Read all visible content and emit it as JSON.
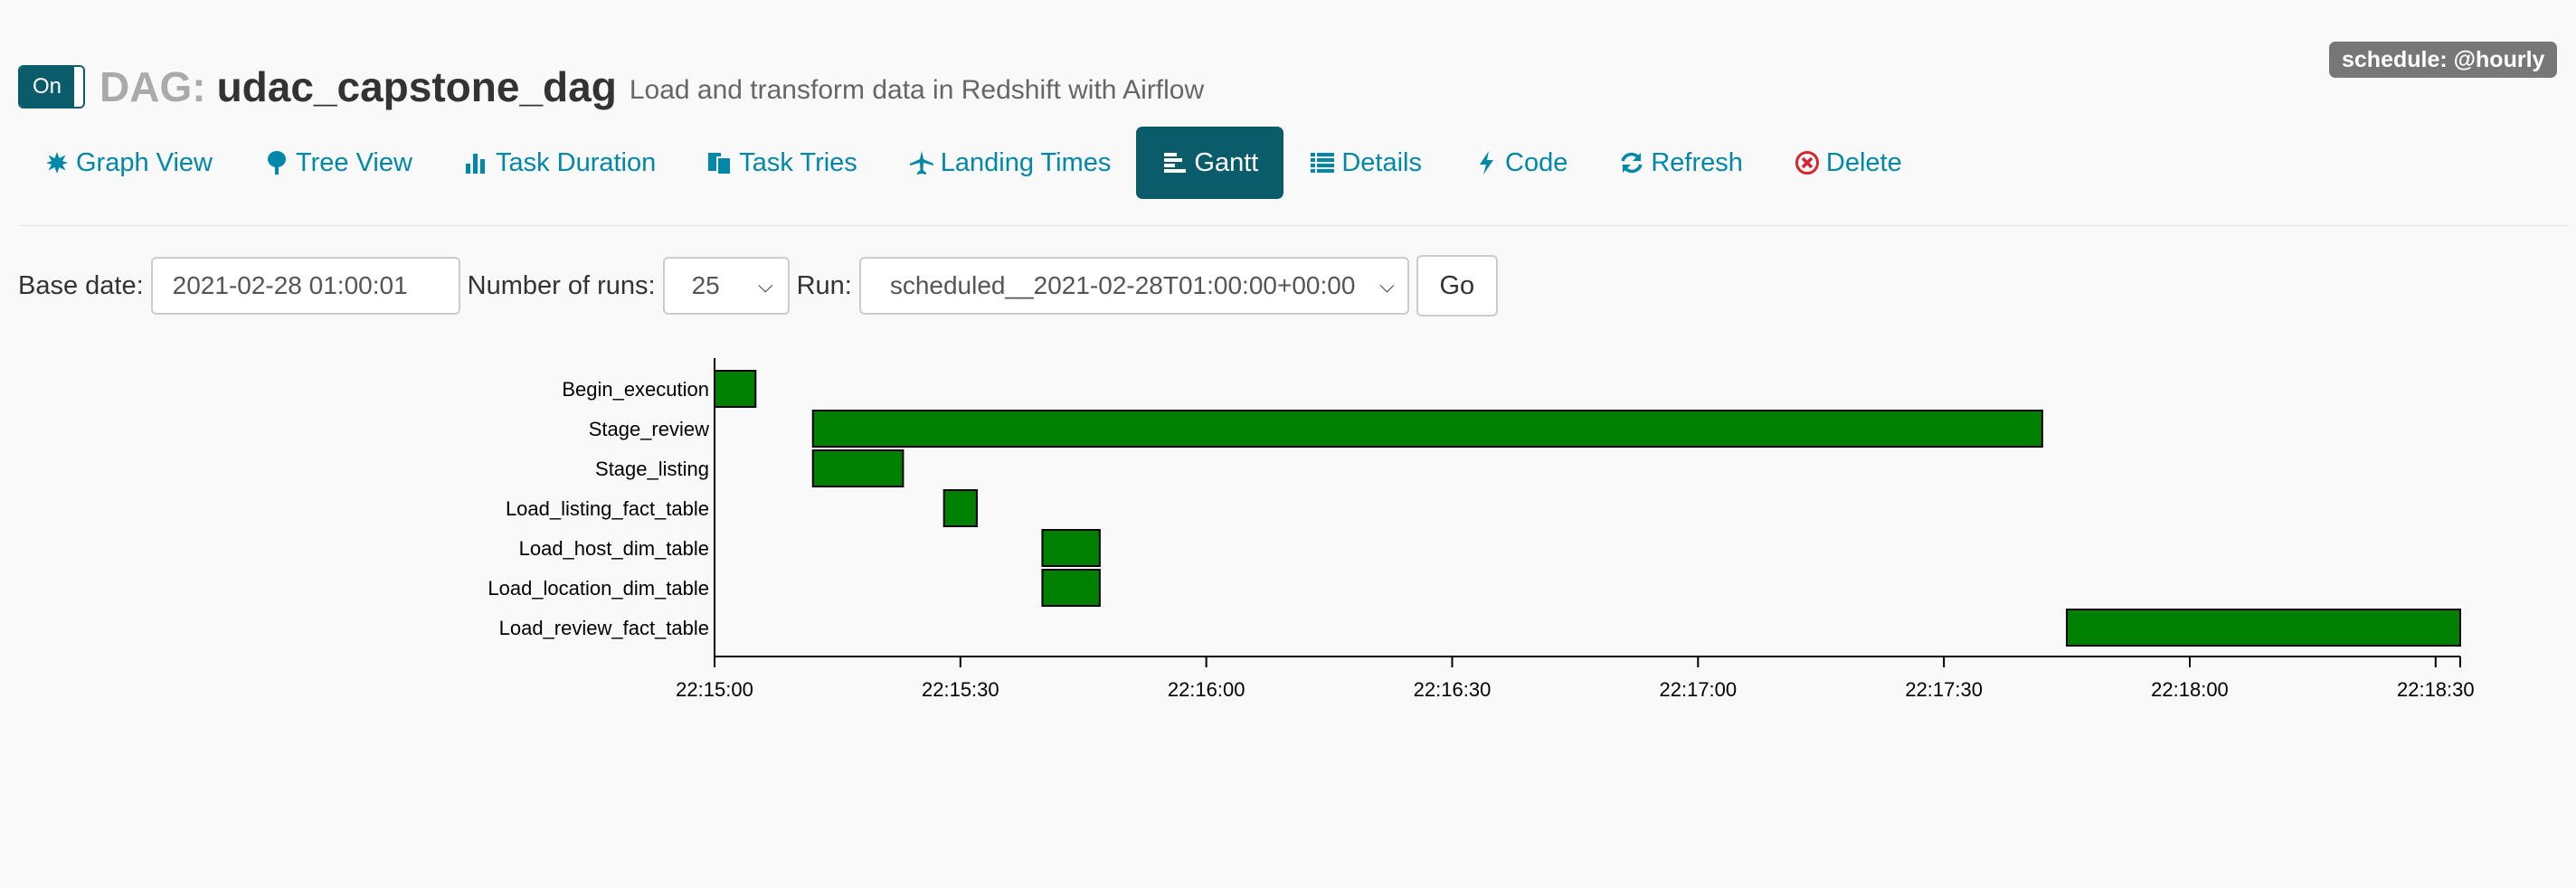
{
  "schedule": "schedule: @hourly",
  "header": {
    "toggle_label": "On",
    "dag_prefix": "DAG:",
    "dag_name": "udac_capstone_dag",
    "description": "Load and transform data in Redshift with Airflow"
  },
  "nav": [
    {
      "label": "Graph View",
      "icon": "graph-icon"
    },
    {
      "label": "Tree View",
      "icon": "tree-icon"
    },
    {
      "label": "Task Duration",
      "icon": "bar-chart-icon"
    },
    {
      "label": "Task Tries",
      "icon": "copy-icon"
    },
    {
      "label": "Landing Times",
      "icon": "plane-icon"
    },
    {
      "label": "Gantt",
      "icon": "align-left-icon",
      "active": true
    },
    {
      "label": "Details",
      "icon": "list-icon"
    },
    {
      "label": "Code",
      "icon": "flash-icon"
    },
    {
      "label": "Refresh",
      "icon": "refresh-icon"
    },
    {
      "label": "Delete",
      "icon": "remove-circle-icon"
    }
  ],
  "form": {
    "base_date_label": "Base date:",
    "base_date_value": "2021-02-28 01:00:01",
    "runs_label": "Number of runs:",
    "runs_value": "25",
    "run_label": "Run:",
    "run_value": "scheduled__2021-02-28T01:00:00+00:00",
    "go_label": "Go"
  },
  "colors": {
    "accent": "#0b5c6b",
    "link": "#0088a8",
    "bar_success": "#008000",
    "schedule_badge": "#777777"
  },
  "chart_data": {
    "type": "gantt",
    "x_unit": "time (HH:MM:SS)",
    "x_range": [
      "22:15:00",
      "22:18:33"
    ],
    "x_ticks": [
      "22:15:00",
      "22:15:30",
      "22:16:00",
      "22:16:30",
      "22:17:00",
      "22:17:30",
      "22:18:00",
      "22:18:30"
    ],
    "tasks": [
      {
        "name": "Begin_execution",
        "start": "22:15:00",
        "end": "22:15:05",
        "state": "success"
      },
      {
        "name": "Stage_review",
        "start": "22:15:12",
        "end": "22:17:42",
        "state": "success"
      },
      {
        "name": "Stage_listing",
        "start": "22:15:12",
        "end": "22:15:23",
        "state": "success"
      },
      {
        "name": "Load_listing_fact_table",
        "start": "22:15:28",
        "end": "22:15:32",
        "state": "success"
      },
      {
        "name": "Load_host_dim_table",
        "start": "22:15:40",
        "end": "22:15:47",
        "state": "success"
      },
      {
        "name": "Load_location_dim_table",
        "start": "22:15:40",
        "end": "22:15:47",
        "state": "success"
      },
      {
        "name": "Load_review_fact_table",
        "start": "22:17:45",
        "end": "22:18:33",
        "state": "success"
      }
    ]
  }
}
